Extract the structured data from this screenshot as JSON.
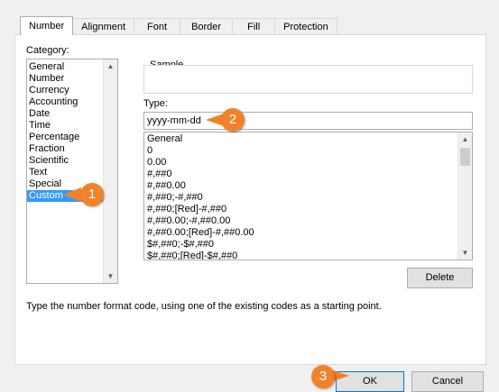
{
  "tabs": [
    "Number",
    "Alignment",
    "Font",
    "Border",
    "Fill",
    "Protection"
  ],
  "category": {
    "label": "Category:",
    "items": [
      "General",
      "Number",
      "Currency",
      "Accounting",
      "Date",
      "Time",
      "Percentage",
      "Fraction",
      "Scientific",
      "Text",
      "Special",
      "Custom"
    ],
    "selected": "Custom"
  },
  "sample": {
    "label": "Sample"
  },
  "type": {
    "label": "Type:",
    "value": "yyyy-mm-dd",
    "formats": [
      "General",
      "0",
      "0.00",
      "#,##0",
      "#,##0.00",
      "#,##0;-#,##0",
      "#,##0;[Red]-#,##0",
      "#,##0.00;-#,##0.00",
      "#,##0.00;[Red]-#,##0.00",
      "$#,##0;-$#,##0",
      "$#,##0;[Red]-$#,##0"
    ]
  },
  "buttons": {
    "delete": "Delete",
    "ok": "OK",
    "cancel": "Cancel"
  },
  "hint": "Type the number format code, using one of the existing codes as a starting point.",
  "callouts": [
    "1",
    "2",
    "3"
  ],
  "colors": {
    "accent": "#f0832a",
    "selection": "#3399ff"
  }
}
